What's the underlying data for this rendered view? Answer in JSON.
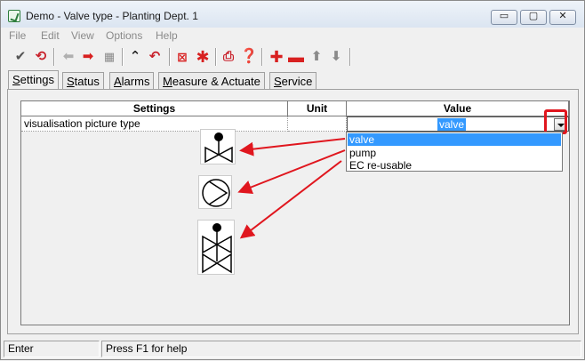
{
  "window": {
    "title": "Demo - Valve type - Planting Dept. 1",
    "controls": {
      "minimize": "▭",
      "maximize": "▢",
      "close": "✕"
    }
  },
  "menu": [
    "File",
    "Edit",
    "View",
    "Options",
    "Help"
  ],
  "toolbar": {
    "icons": [
      "check-icon",
      "refresh-icon",
      "arrow-left-icon",
      "arrow-right-icon",
      "list-icon",
      "collapse-icon",
      "undo-icon",
      "delete-icon",
      "asterisk-icon",
      "print-icon",
      "help-icon",
      "add-icon",
      "remove-icon",
      "move-up-icon",
      "move-down-icon"
    ]
  },
  "tabs": [
    {
      "label_ul": "S",
      "label_rest": "ettings",
      "active": true
    },
    {
      "label_ul": "S",
      "label_rest": "tatus",
      "active": false
    },
    {
      "label_ul": "A",
      "label_rest": "larms",
      "active": false
    },
    {
      "label_ul": "M",
      "label_rest": "easure & Actuate",
      "active": false
    },
    {
      "label_ul": "S",
      "label_rest": "ervice",
      "active": false
    }
  ],
  "grid": {
    "columns": [
      "Settings",
      "Unit",
      "Value"
    ],
    "rows": [
      {
        "setting": "visualisation picture type",
        "unit": "",
        "value": "valve"
      }
    ]
  },
  "dropdown": {
    "options": [
      "valve",
      "pump",
      "EC re-usable"
    ],
    "selected_index": 0
  },
  "pictures": [
    "valve-symbol-icon",
    "pump-symbol-icon",
    "ec-reusable-symbol-icon"
  ],
  "statusbar": {
    "mode": "Enter",
    "hint": "Press F1 for help"
  },
  "colors": {
    "highlight": "#3399ff",
    "annotation": "#e0161e"
  }
}
